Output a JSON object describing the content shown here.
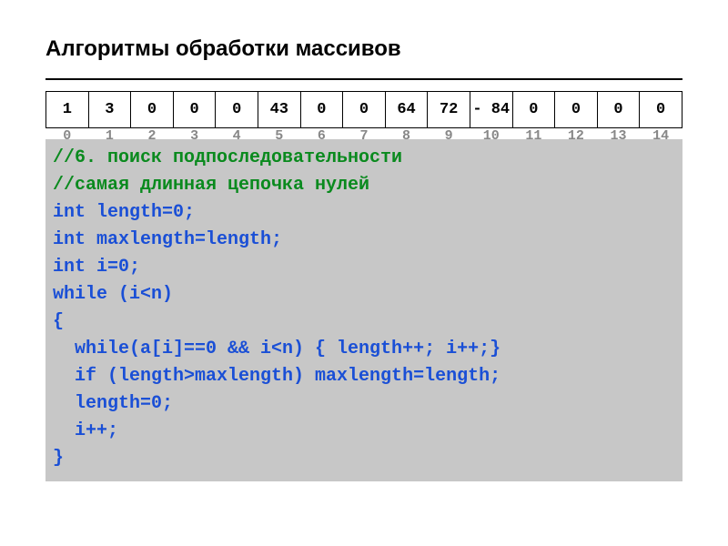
{
  "title": "Алгоритмы обработки массивов",
  "array": {
    "values": [
      "1",
      "3",
      "0",
      "0",
      "0",
      "43",
      "0",
      "0",
      "64",
      "72",
      "-\n84",
      "0",
      "0",
      "0",
      "0"
    ],
    "indices": [
      "0",
      "1",
      "2",
      "3",
      "4",
      "5",
      "6",
      "7",
      "8",
      "9",
      "10",
      "11",
      "12",
      "13",
      "14"
    ]
  },
  "code": {
    "c0": "//6. поиск подпоследовательности",
    "c1": "//самая длинная цепочка нулей",
    "l0": "int length=0;",
    "l1": "int maxlength=length;",
    "l2": "int i=0;",
    "l3": "while (i<n)",
    "l4": "{",
    "l5": "  while(a[i]==0 && i<n) { length++; i++;}",
    "l6": "  if (length>maxlength) maxlength=length;",
    "l7": "  length=0;",
    "l8": "  i++;",
    "l9": "}"
  }
}
